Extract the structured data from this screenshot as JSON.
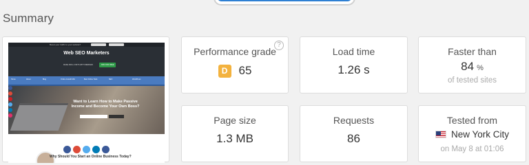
{
  "header": {
    "title": "Summary"
  },
  "preview": {
    "brand": "Web SEO Marketers",
    "topbar_text": "Boost your traffic to your website?",
    "subline": "MAKE 3000+ VISITS WITH WEBINAR",
    "sub_button": "JOIN FOR FREE",
    "nav": [
      "Home",
      "About",
      "Blog",
      "Online Growth Mkt",
      "Best Online Tools",
      "SEO",
      "WordPress"
    ],
    "hero_title": "Want to Learn How to Make Passive Income and Become Your Own Boss?",
    "bottom_text": "Why Should You Start an Online Business Today?",
    "colors": {
      "top": "#2a2f35",
      "nav": "#4a7bc0",
      "cta": "#2e9a48"
    }
  },
  "metrics": {
    "performance": {
      "title": "Performance grade",
      "grade": "D",
      "score": "65",
      "help_icon": "?",
      "badge_color": "#f3b23e"
    },
    "load_time": {
      "title": "Load time",
      "value": "1.26 s"
    },
    "faster_than": {
      "title": "Faster than",
      "value": "84",
      "unit": "%",
      "caption": "of tested sites"
    },
    "page_size": {
      "title": "Page size",
      "value": "1.3 MB"
    },
    "requests": {
      "title": "Requests",
      "value": "86"
    },
    "tested_from": {
      "title": "Tested from",
      "location": "New York City",
      "flag_icon": "us-flag-icon",
      "date": "on May 8 at 01:06"
    }
  }
}
